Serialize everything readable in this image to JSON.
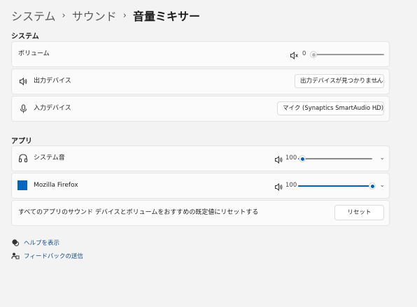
{
  "breadcrumb": {
    "items": [
      "システム",
      "サウンド"
    ],
    "current": "音量ミキサー",
    "separator": "›"
  },
  "system_section": {
    "title": "システム",
    "volume": {
      "label": "ボリューム",
      "value": "0",
      "muted": true,
      "level": 0
    },
    "output": {
      "label": "出力デバイス",
      "selected": "出力デバイスが見つかりません"
    },
    "input": {
      "label": "入力デバイス",
      "selected": "マイク (Synaptics SmartAudio HD)"
    }
  },
  "apps_section": {
    "title": "アプリ",
    "apps": [
      {
        "name": "システム音",
        "volume": "100",
        "level": 0.06,
        "icon": "headphones-icon"
      },
      {
        "name": "Mozilla Firefox",
        "volume": "100",
        "level": 1.0,
        "icon": "firefox-app-icon"
      }
    ],
    "reset": {
      "text": "すべてのアプリのサウンド デバイスとボリュームをおすすめの既定値にリセットする",
      "button": "リセット"
    }
  },
  "links": {
    "help": "ヘルプを表示",
    "feedback": "フィードバックの送信"
  },
  "colors": {
    "accent": "#005fb8",
    "background": "#f3f3f3",
    "card": "#fbfbfb"
  }
}
